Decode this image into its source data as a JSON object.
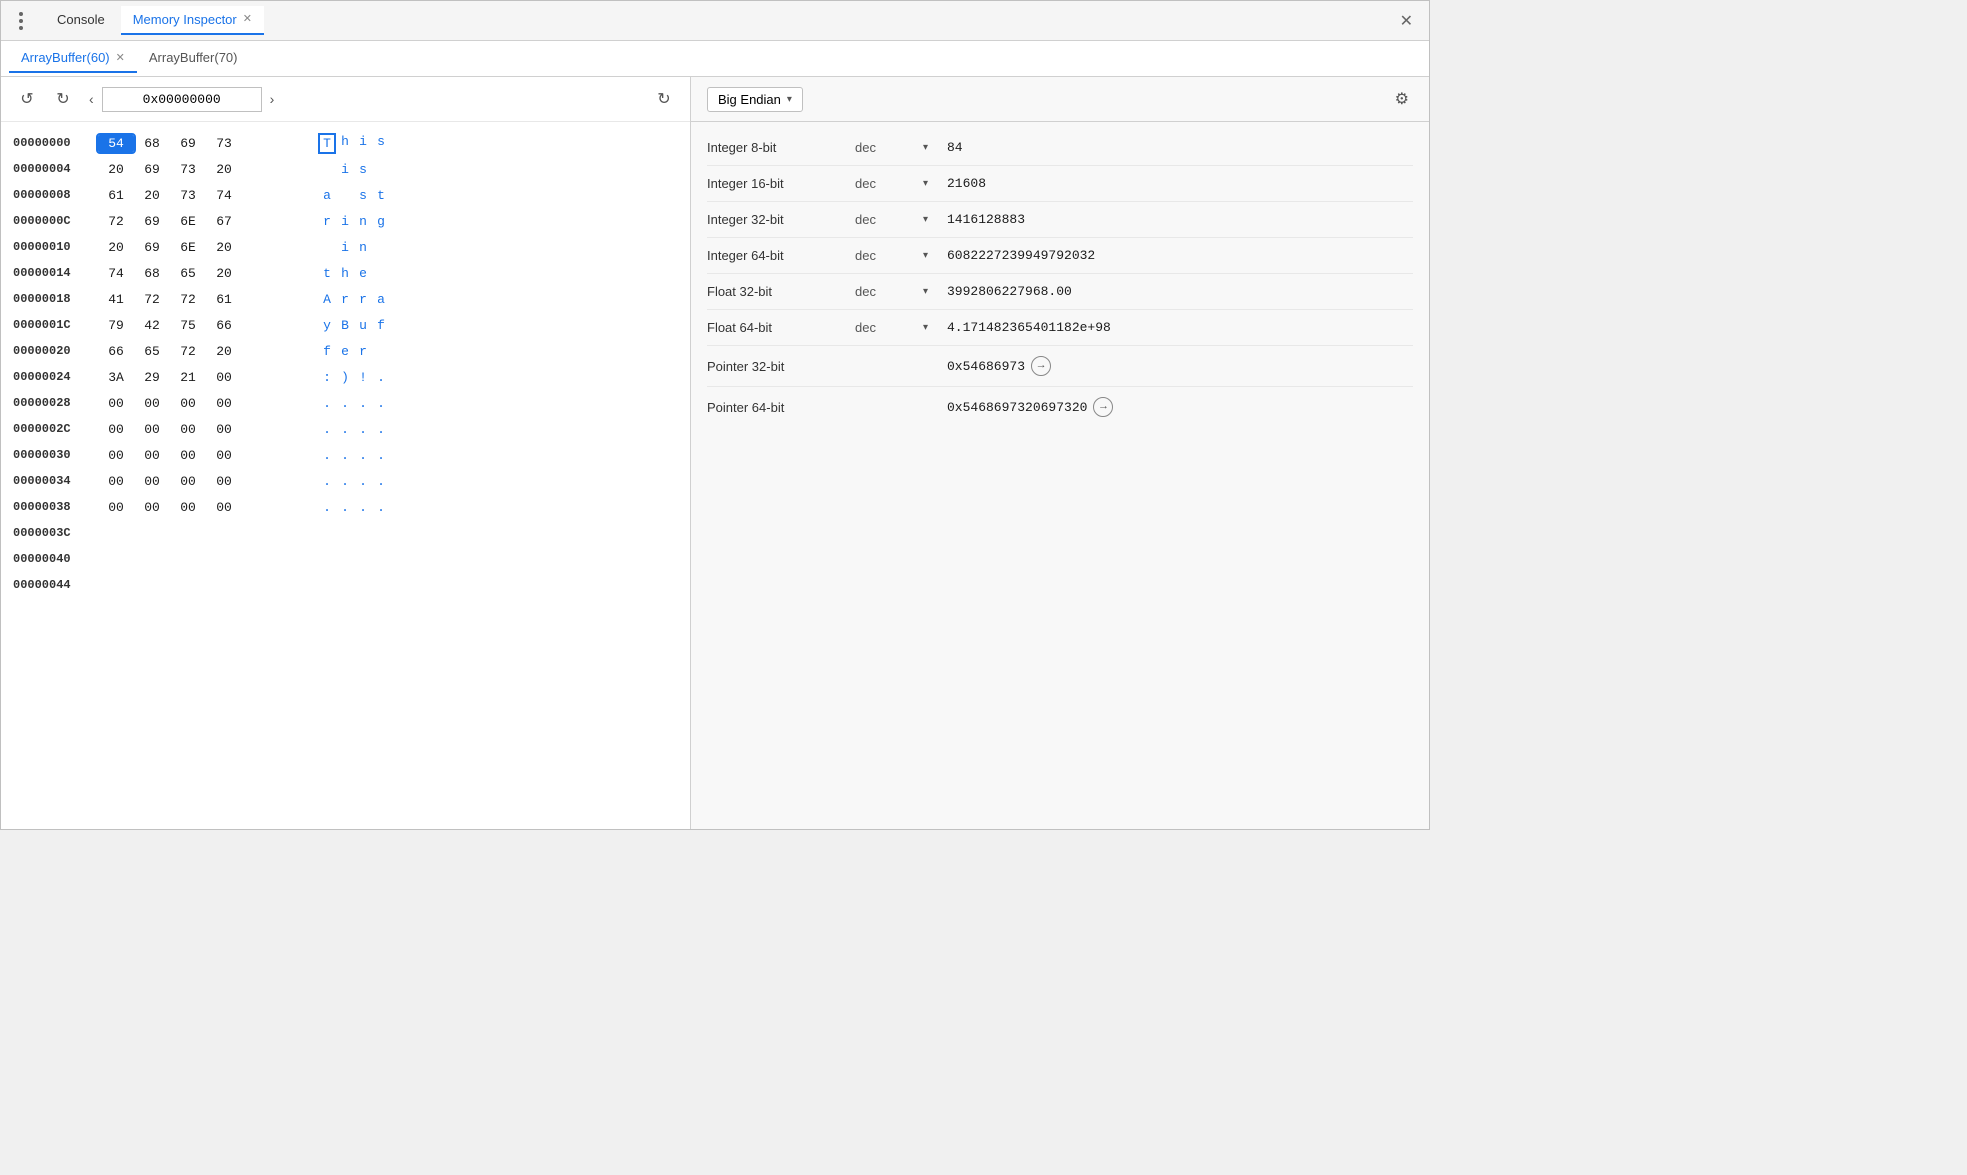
{
  "window": {
    "close_label": "✕"
  },
  "top_tabs": {
    "items": [
      {
        "id": "console",
        "label": "Console",
        "active": false,
        "closeable": false
      },
      {
        "id": "memory-inspector",
        "label": "Memory Inspector",
        "active": true,
        "closeable": true
      }
    ]
  },
  "buffer_tabs": {
    "items": [
      {
        "id": "buf60",
        "label": "ArrayBuffer(60)",
        "active": true,
        "closeable": true
      },
      {
        "id": "buf70",
        "label": "ArrayBuffer(70)",
        "active": false,
        "closeable": false
      }
    ]
  },
  "nav": {
    "back_label": "←",
    "forward_label": "→",
    "prev_label": "‹",
    "next_label": "›",
    "address": "0x00000000",
    "refresh_label": "↻"
  },
  "hex_rows": [
    {
      "addr": "00000000",
      "bytes": [
        "54",
        "68",
        "69",
        "73"
      ],
      "chars": [
        "T",
        "h",
        "i",
        "s"
      ],
      "selected_byte": 0,
      "selected_char": 0
    },
    {
      "addr": "00000004",
      "bytes": [
        "20",
        "69",
        "73",
        "20"
      ],
      "chars": [
        " ",
        "i",
        "s",
        " "
      ],
      "selected_byte": -1,
      "selected_char": -1
    },
    {
      "addr": "00000008",
      "bytes": [
        "61",
        "20",
        "73",
        "74"
      ],
      "chars": [
        "a",
        " ",
        "s",
        "t"
      ],
      "selected_byte": -1,
      "selected_char": -1
    },
    {
      "addr": "0000000C",
      "bytes": [
        "72",
        "69",
        "6E",
        "67"
      ],
      "chars": [
        "r",
        "i",
        "n",
        "g"
      ],
      "selected_byte": -1,
      "selected_char": -1
    },
    {
      "addr": "00000010",
      "bytes": [
        "20",
        "69",
        "6E",
        "20"
      ],
      "chars": [
        " ",
        "i",
        "n",
        " "
      ],
      "selected_byte": -1,
      "selected_char": -1
    },
    {
      "addr": "00000014",
      "bytes": [
        "74",
        "68",
        "65",
        "20"
      ],
      "chars": [
        "t",
        "h",
        "e",
        " "
      ],
      "selected_byte": -1,
      "selected_char": -1
    },
    {
      "addr": "00000018",
      "bytes": [
        "41",
        "72",
        "72",
        "61"
      ],
      "chars": [
        "A",
        "r",
        "r",
        "a"
      ],
      "selected_byte": -1,
      "selected_char": -1
    },
    {
      "addr": "0000001C",
      "bytes": [
        "79",
        "42",
        "75",
        "66"
      ],
      "chars": [
        "y",
        "B",
        "u",
        "f"
      ],
      "selected_byte": -1,
      "selected_char": -1
    },
    {
      "addr": "00000020",
      "bytes": [
        "66",
        "65",
        "72",
        "20"
      ],
      "chars": [
        "f",
        "e",
        "r",
        " "
      ],
      "selected_byte": -1,
      "selected_char": -1
    },
    {
      "addr": "00000024",
      "bytes": [
        "3A",
        "29",
        "21",
        "00"
      ],
      "chars": [
        ":",
        ")",
        "!",
        "."
      ],
      "selected_byte": -1,
      "selected_char": -1
    },
    {
      "addr": "00000028",
      "bytes": [
        "00",
        "00",
        "00",
        "00"
      ],
      "chars": [
        ".",
        ".",
        ".",
        "."
      ],
      "selected_byte": -1,
      "selected_char": -1
    },
    {
      "addr": "0000002C",
      "bytes": [
        "00",
        "00",
        "00",
        "00"
      ],
      "chars": [
        ".",
        ".",
        ".",
        "."
      ],
      "selected_byte": -1,
      "selected_char": -1
    },
    {
      "addr": "00000030",
      "bytes": [
        "00",
        "00",
        "00",
        "00"
      ],
      "chars": [
        ".",
        ".",
        ".",
        "."
      ],
      "selected_byte": -1,
      "selected_char": -1
    },
    {
      "addr": "00000034",
      "bytes": [
        "00",
        "00",
        "00",
        "00"
      ],
      "chars": [
        ".",
        ".",
        ".",
        "."
      ],
      "selected_byte": -1,
      "selected_char": -1
    },
    {
      "addr": "00000038",
      "bytes": [
        "00",
        "00",
        "00",
        "00"
      ],
      "chars": [
        ".",
        ".",
        ".",
        "."
      ],
      "selected_byte": -1,
      "selected_char": -1
    },
    {
      "addr": "0000003C",
      "bytes": [],
      "chars": [],
      "selected_byte": -1,
      "selected_char": -1
    },
    {
      "addr": "00000040",
      "bytes": [],
      "chars": [],
      "selected_byte": -1,
      "selected_char": -1
    },
    {
      "addr": "00000044",
      "bytes": [],
      "chars": [],
      "selected_byte": -1,
      "selected_char": -1
    }
  ],
  "right_panel": {
    "endian": {
      "label": "Big Endian",
      "arrow": "▾"
    },
    "gear_label": "⚙",
    "inspector_rows": [
      {
        "id": "int8",
        "label": "Integer 8-bit",
        "format": "dec",
        "has_dropdown": true,
        "value": "84",
        "is_pointer": false
      },
      {
        "id": "int16",
        "label": "Integer 16-bit",
        "format": "dec",
        "has_dropdown": true,
        "value": "21608",
        "is_pointer": false
      },
      {
        "id": "int32",
        "label": "Integer 32-bit",
        "format": "dec",
        "has_dropdown": true,
        "value": "1416128883",
        "is_pointer": false
      },
      {
        "id": "int64",
        "label": "Integer 64-bit",
        "format": "dec",
        "has_dropdown": true,
        "value": "6082227239949792032",
        "is_pointer": false
      },
      {
        "id": "float32",
        "label": "Float 32-bit",
        "format": "dec",
        "has_dropdown": true,
        "value": "3992806227968.00",
        "is_pointer": false
      },
      {
        "id": "float64",
        "label": "Float 64-bit",
        "format": "dec",
        "has_dropdown": true,
        "value": "4.17148236540118​2e+98",
        "is_pointer": false
      },
      {
        "id": "ptr32",
        "label": "Pointer 32-bit",
        "format": "",
        "has_dropdown": false,
        "value": "0x54686973",
        "is_pointer": true
      },
      {
        "id": "ptr64",
        "label": "Pointer 64-bit",
        "format": "",
        "has_dropdown": false,
        "value": "0x5468697320697320",
        "is_pointer": true
      }
    ]
  }
}
